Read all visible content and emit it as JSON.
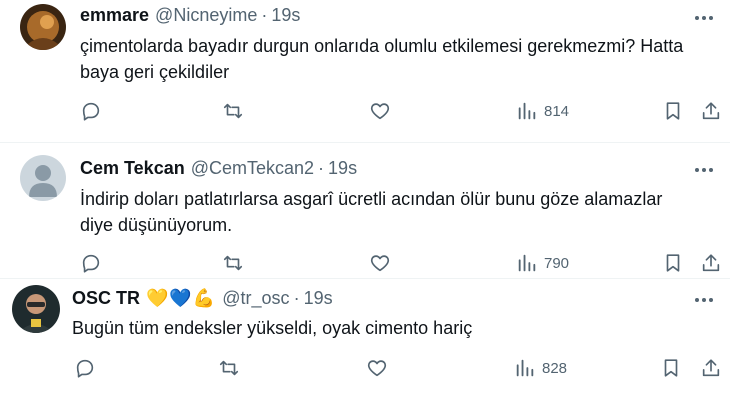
{
  "tweets": [
    {
      "display_name": "emmare",
      "handle": "@Nicneyime",
      "separator": "·",
      "time": "19s",
      "emoji": "",
      "text_line1": "çimentolarda bayadır durgun onlarıda olumlu etkilemesi gerekmezmi? Hatta",
      "text_line2": "baya geri çekildiler",
      "views": "814"
    },
    {
      "display_name": "Cem Tekcan",
      "handle": "@CemTekcan2",
      "separator": "·",
      "time": "19s",
      "emoji": "",
      "text_line1": "İndirip doları patlatırlarsa asgarî ücretli acından ölür bunu göze alamazlar",
      "text_line2": "diye düşünüyorum.",
      "views": "790"
    },
    {
      "display_name": "OSC TR",
      "handle": "@tr_osc",
      "separator": "·",
      "time": "19s",
      "emoji": "💛💙💪",
      "text_line1": "Bugün  tüm endeksler yükseldi,  oyak cimento hariç",
      "text_line2": "",
      "views": "828"
    }
  ],
  "icons": {
    "reply": "reply-icon",
    "retweet": "retweet-icon",
    "like": "like-icon",
    "views": "views-icon",
    "bookmark": "bookmark-icon",
    "share": "share-icon",
    "more": "more-options-icon"
  },
  "colors": {
    "text": "#0f1419",
    "secondary": "#536471",
    "divider": "#eff3f4"
  }
}
